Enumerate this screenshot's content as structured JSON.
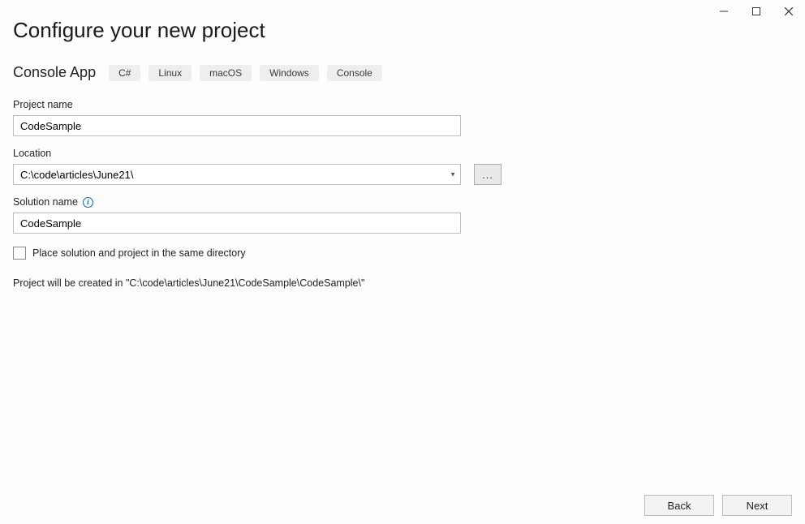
{
  "window": {
    "title": "Configure your new project"
  },
  "template": {
    "name": "Console App",
    "tags": [
      "C#",
      "Linux",
      "macOS",
      "Windows",
      "Console"
    ]
  },
  "fields": {
    "project_name": {
      "label": "Project name",
      "value": "CodeSample"
    },
    "location": {
      "label": "Location",
      "value": "C:\\code\\articles\\June21\\",
      "browse_label": "..."
    },
    "solution_name": {
      "label": "Solution name",
      "value": "CodeSample"
    },
    "same_directory": {
      "label": "Place solution and project in the same directory",
      "checked": false
    }
  },
  "summary": "Project will be created in \"C:\\code\\articles\\June21\\CodeSample\\CodeSample\\\"",
  "buttons": {
    "back": "Back",
    "next": "Next"
  }
}
